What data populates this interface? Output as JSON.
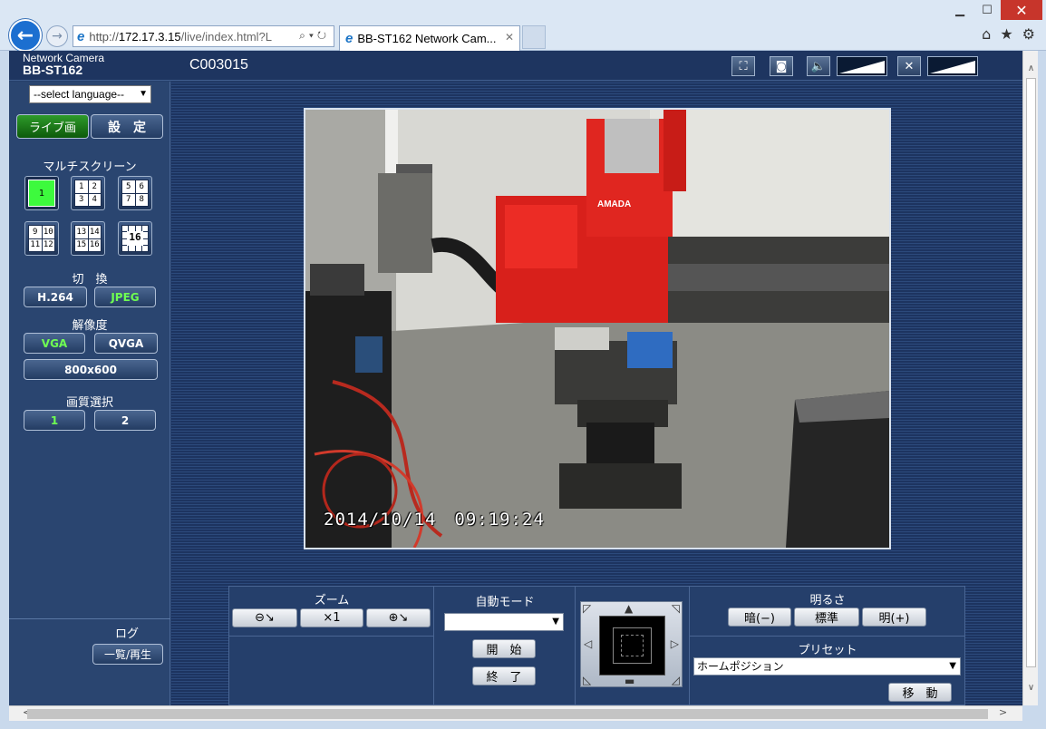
{
  "browser": {
    "window_controls": {
      "minimize": "▁",
      "maximize": "☐",
      "close": "✕"
    },
    "back_icon": "back-arrow-icon",
    "forward_icon": "forward-arrow-icon",
    "address": {
      "scheme": "http://",
      "host": "172.17.3.15",
      "path": "/live/index.html?L"
    },
    "tab_title": "BB-ST162 Network Cam...",
    "tab_close": "✕",
    "toolbar_icons": [
      "home-icon",
      "star-icon",
      "gear-icon"
    ]
  },
  "header": {
    "product_line": "Network Camera",
    "model": "BB-ST162",
    "camera_title": "C003015"
  },
  "sidebar": {
    "language_select": "--select language--",
    "live_tab": "ライブ画",
    "settings_tab": "設　定",
    "multiscreen_label": "マルチスクリーン",
    "multiscreen": {
      "single": "1",
      "quad_a": [
        "1",
        "2",
        "3",
        "4"
      ],
      "quad_b": [
        "5",
        "6",
        "7",
        "8"
      ],
      "quad_c": [
        "9",
        "10",
        "11",
        "12"
      ],
      "quad_d": [
        "13",
        "14",
        "15",
        "16"
      ],
      "sixteen": "16"
    },
    "switch_label": "切　換",
    "codec_h264": "H.264",
    "codec_jpeg": "JPEG",
    "resolution_label": "解像度",
    "res_vga": "VGA",
    "res_qvga": "QVGA",
    "res_800": "800x600",
    "quality_label": "画質選択",
    "quality_1": "1",
    "quality_2": "2",
    "log_label": "ログ",
    "log_button": "一覧/再生"
  },
  "video": {
    "timestamp": "2014/10/14　09:19:24",
    "brand_on_robot": "AMADA"
  },
  "controls": {
    "zoom_label": "ズーム",
    "zoom_reset": "×1",
    "auto_mode_label": "自動モード",
    "auto_mode_value": "",
    "start_button": "開　始",
    "stop_button": "終　了",
    "brightness_label": "明るさ",
    "dark_button": "暗(−)",
    "standard_button": "標準",
    "bright_button": "明(+)",
    "preset_label": "プリセット",
    "preset_value": "ホームポジション",
    "move_button": "移　動"
  },
  "colors": {
    "page_bg": "#253f6b",
    "active_green": "#2e9a2a",
    "selected_text_green": "#6fff52"
  }
}
